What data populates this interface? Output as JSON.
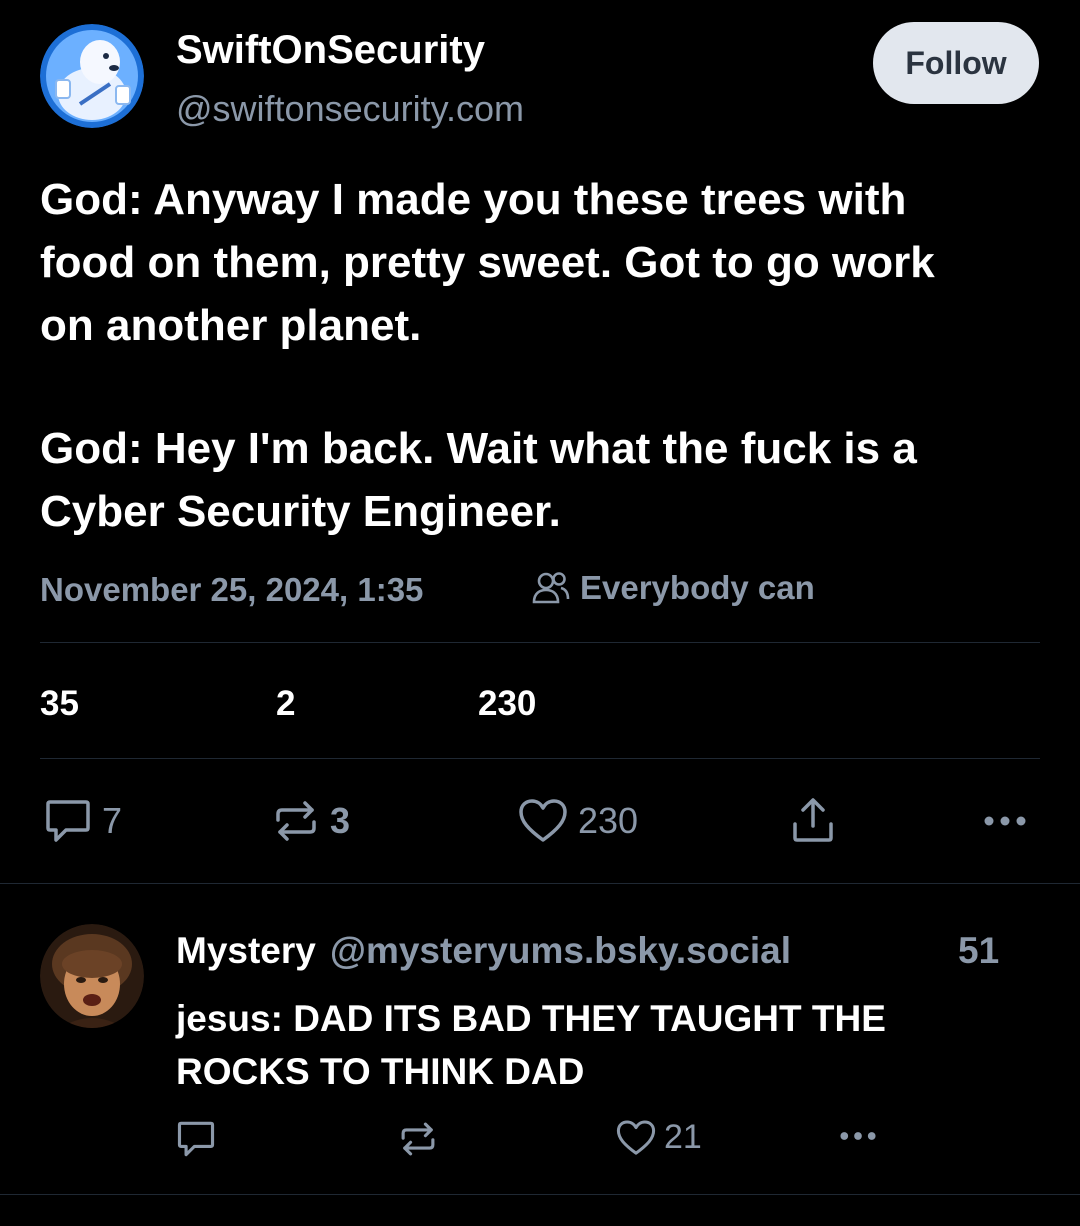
{
  "post": {
    "author": {
      "display_name": "SwiftOnSecurity",
      "handle": "@swiftonsecurity.com"
    },
    "follow_label": "Follow",
    "text_lines": [
      "God: Anyway I made you these trees with",
      "food on them, pretty sweet. Got to go work",
      "on another planet.",
      "God: Hey I'm back. Wait what the fuck is a",
      "Cyber Security Engineer."
    ],
    "timestamp": "November 25, 2024, 1:35",
    "audience": "Everybody can",
    "stats": [
      "35",
      "2",
      "230"
    ],
    "actions": {
      "replies": "7",
      "reposts": "3",
      "likes": "230"
    }
  },
  "reply": {
    "display_name": "Mystery",
    "handle": "@mysteryums.bsky.social",
    "age": "51",
    "text_lines": [
      "jesus: DAD ITS BAD THEY TAUGHT THE",
      "ROCKS TO THINK DAD"
    ],
    "likes": "21"
  },
  "colors": {
    "background": "#000000",
    "text": "#ffffff",
    "muted": "#8b98a9",
    "divider": "#1f2833",
    "follow_bg": "#e2e7ee",
    "follow_text": "#2b3440"
  },
  "icons": [
    "avatar-seal",
    "avatar-portrait",
    "people-icon",
    "comment-icon",
    "repost-icon",
    "heart-icon",
    "share-icon",
    "more-icon"
  ]
}
